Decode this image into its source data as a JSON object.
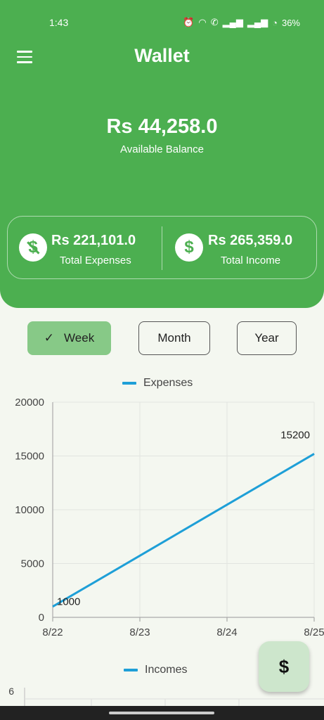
{
  "status": {
    "time": "1:43",
    "battery": "36%"
  },
  "header": {
    "title": "Wallet",
    "balance": "Rs 44,258.0",
    "balance_label": "Available Balance"
  },
  "summary": {
    "expenses_amount": "Rs 221,101.0",
    "expenses_label": "Total Expenses",
    "income_amount": "Rs 265,359.0",
    "income_label": "Total Income"
  },
  "periods": {
    "week": "Week",
    "month": "Month",
    "year": "Year",
    "selected": "Week"
  },
  "fab_symbol": "$",
  "colors": {
    "primary": "#4caf50",
    "series": "#1e9fd7",
    "selected_chip": "#87c987"
  },
  "chart_data": [
    {
      "type": "line",
      "legend": "Expenses",
      "x": [
        "8/22",
        "8/23",
        "8/24",
        "8/25"
      ],
      "series": [
        {
          "name": "Expenses",
          "values": [
            1000,
            5733,
            10467,
            15200
          ]
        }
      ],
      "data_labels": [
        "1000",
        "15200"
      ],
      "yticks": [
        "0",
        "5000",
        "10000",
        "15000",
        "20000"
      ],
      "ylim": [
        0,
        20000
      ],
      "grid": true
    },
    {
      "type": "line",
      "legend": "Incomes",
      "yticks": [
        "6"
      ]
    }
  ]
}
